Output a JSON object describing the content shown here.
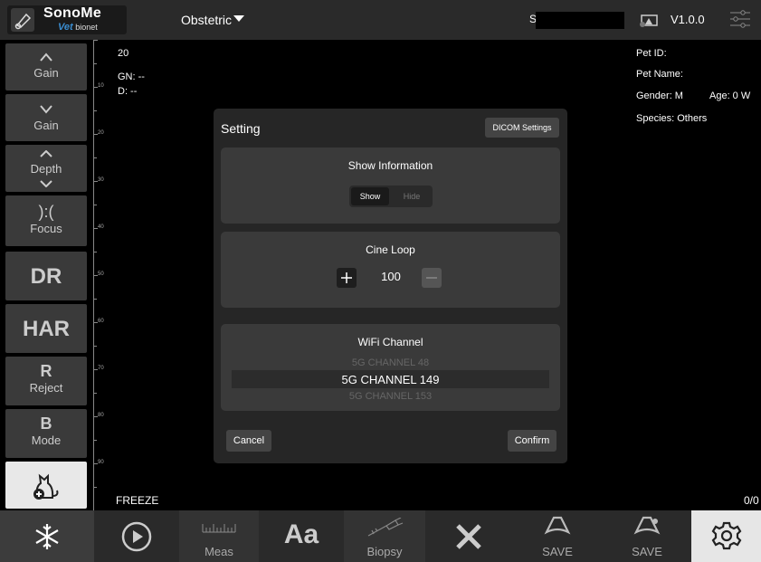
{
  "header": {
    "logo_title": "SonoMe",
    "logo_vet": "Vet",
    "logo_brand": "bionet",
    "mode": "Obstetric",
    "serial_prefix": "S",
    "version": "V1.0.0"
  },
  "left_panel": {
    "gain_up": "Gain",
    "gain_down": "Gain",
    "depth": "Depth",
    "focus_glyph": "):(",
    "focus": "Focus",
    "dr": "DR",
    "har": "HAR",
    "reject_letter": "R",
    "reject": "Reject",
    "mode_letter": "B",
    "mode": "Mode"
  },
  "ruler": {
    "ticks": [
      "10",
      "20",
      "30",
      "40",
      "50",
      "60",
      "70",
      "80",
      "90"
    ]
  },
  "image_info": {
    "depth_value": "20",
    "gn": "GN: --",
    "d": "D: --",
    "freeze": "FREEZE",
    "counter": "0/0"
  },
  "patient": {
    "pet_id": "Pet ID:",
    "pet_name": "Pet Name:",
    "gender": "Gender: M",
    "age": "Age: 0 W",
    "species": "Species: Others"
  },
  "dialog": {
    "title": "Setting",
    "dicom_settings": "DICOM Settings",
    "show_info_title": "Show Information",
    "show": "Show",
    "hide": "Hide",
    "show_selected": "Show",
    "cine_title": "Cine Loop",
    "cine_value": "100",
    "wifi_title": "WiFi Channel",
    "wifi_options": [
      "5G CHANNEL 48",
      "5G CHANNEL 149",
      "5G CHANNEL 153"
    ],
    "wifi_selected": "5G CHANNEL 149",
    "cancel": "Cancel",
    "confirm": "Confirm"
  },
  "bottom_bar": {
    "meas": "Meas",
    "text_glyph": "Aa",
    "biopsy": "Biopsy",
    "save_image": "SAVE",
    "save_cine": "SAVE"
  },
  "colors": {
    "background": "#000000",
    "panel": "#3a3a3a",
    "bar": "#2a2a2a",
    "dialog": "#262626",
    "brand_blue": "#3a8dd0"
  }
}
